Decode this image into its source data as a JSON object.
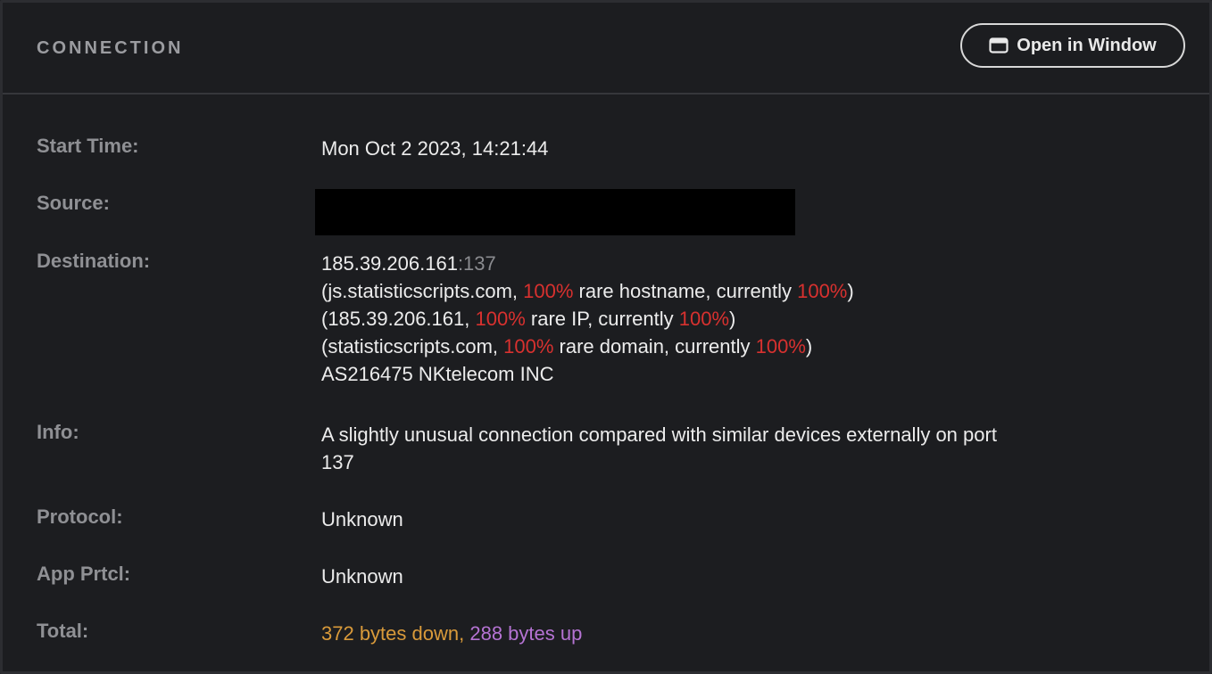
{
  "header": {
    "title": "CONNECTION",
    "open_window_label": "Open in Window",
    "open_window_icon": "window-icon"
  },
  "rows": {
    "start_time": {
      "label": "Start Time:",
      "value": "Mon Oct 2 2023, 14:21:44"
    },
    "source": {
      "label": "Source:",
      "value": ""
    },
    "destination": {
      "label": "Destination:",
      "ip": "185.39.206.161",
      "port": ":137",
      "hostname_line": {
        "prefix": "(js.statisticscripts.com, ",
        "pct": "100%",
        "mid": " rare hostname, currently ",
        "current": "100%",
        "suffix": ")"
      },
      "ip_line": {
        "prefix": "(185.39.206.161, ",
        "pct": "100%",
        "mid": " rare IP, currently ",
        "current": "100%",
        "suffix": ")"
      },
      "domain_line": {
        "prefix": "(statisticscripts.com, ",
        "pct": "100%",
        "mid": " rare domain, currently ",
        "current": "100%",
        "suffix": ")"
      },
      "asn": "AS216475 NKtelecom INC"
    },
    "info": {
      "label": "Info:",
      "line1": "A slightly unusual connection compared with similar devices externally on port",
      "line2": "137"
    },
    "protocol": {
      "label": "Protocol:",
      "value": "Unknown"
    },
    "app_protocol": {
      "label": "App Prtcl:",
      "value": "Unknown"
    },
    "total": {
      "label": "Total:",
      "down": "372 bytes down",
      "separator": ", ",
      "up": "288 bytes up"
    }
  },
  "colors": {
    "background": "#1c1d20",
    "rare": "#d8312f",
    "down": "#d99a3a",
    "up": "#b573d3"
  }
}
